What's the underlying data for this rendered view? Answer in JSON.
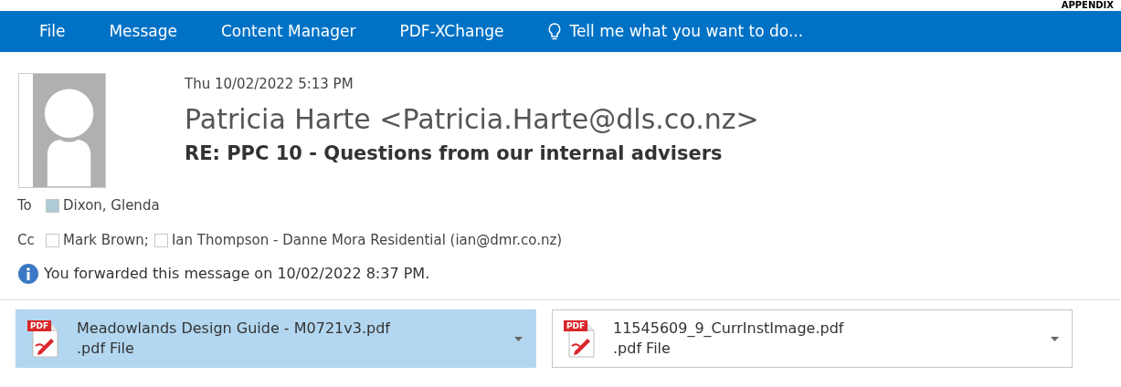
{
  "corner_label": "APPENDIX",
  "ribbon": {
    "tabs": [
      {
        "label": "File"
      },
      {
        "label": "Message"
      },
      {
        "label": "Content Manager"
      },
      {
        "label": "PDF-XChange"
      }
    ],
    "tell_me": "Tell me what you want to do..."
  },
  "message": {
    "date": "Thu 10/02/2022 5:13 PM",
    "sender": "Patricia Harte <Patricia.Harte@dls.co.nz>",
    "subject": "RE: PPC 10 - Questions from our internal advisers",
    "to": {
      "label": "To",
      "recipients": [
        {
          "name": "Dixon, Glenda",
          "color": "#aecbd6"
        }
      ]
    },
    "cc": {
      "label": "Cc",
      "recipients": [
        {
          "name": "Mark Brown;",
          "color": "#ffffff"
        },
        {
          "name": "Ian Thompson - Danne Mora Residential (ian@dmr.co.nz)",
          "color": "#ffffff"
        }
      ]
    },
    "info": "You forwarded this message on 10/02/2022 8:37 PM."
  },
  "attachments": [
    {
      "name": "Meadowlands Design Guide - M0721v3.pdf",
      "type": ".pdf File",
      "icon_label": "PDF",
      "selected": true
    },
    {
      "name": "11545609_9_CurrInstImage.pdf",
      "type": ".pdf File",
      "icon_label": "PDF",
      "selected": false
    }
  ]
}
